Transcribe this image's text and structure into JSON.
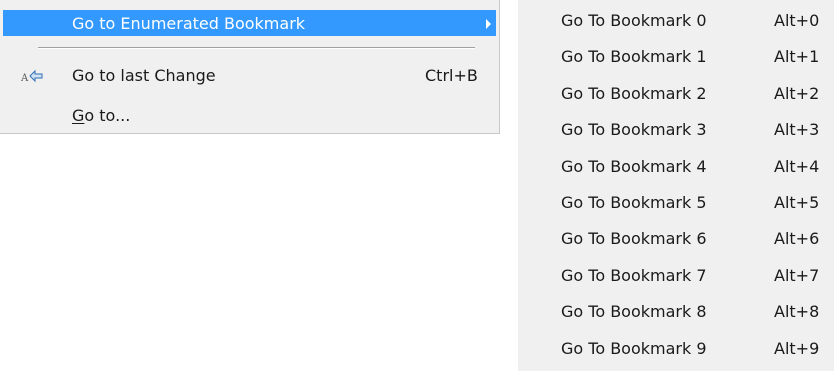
{
  "main_menu": {
    "enumerated_bookmark_label": "Go to Enumerated Bookmark",
    "last_change_label": "Go to last Change",
    "last_change_shortcut": "Ctrl+B",
    "goto_mnemonic": "G",
    "goto_rest": "o to...",
    "highlight_color": "#3399ff"
  },
  "submenu": {
    "items": [
      {
        "label": "Go To Bookmark 0",
        "shortcut": "Alt+0"
      },
      {
        "label": "Go To Bookmark 1",
        "shortcut": "Alt+1"
      },
      {
        "label": "Go To Bookmark 2",
        "shortcut": "Alt+2"
      },
      {
        "label": "Go To Bookmark 3",
        "shortcut": "Alt+3"
      },
      {
        "label": "Go To Bookmark 4",
        "shortcut": "Alt+4"
      },
      {
        "label": "Go To Bookmark 5",
        "shortcut": "Alt+5"
      },
      {
        "label": "Go To Bookmark 6",
        "shortcut": "Alt+6"
      },
      {
        "label": "Go To Bookmark 7",
        "shortcut": "Alt+7"
      },
      {
        "label": "Go To Bookmark 8",
        "shortcut": "Alt+8"
      },
      {
        "label": "Go To Bookmark 9",
        "shortcut": "Alt+9"
      }
    ]
  }
}
